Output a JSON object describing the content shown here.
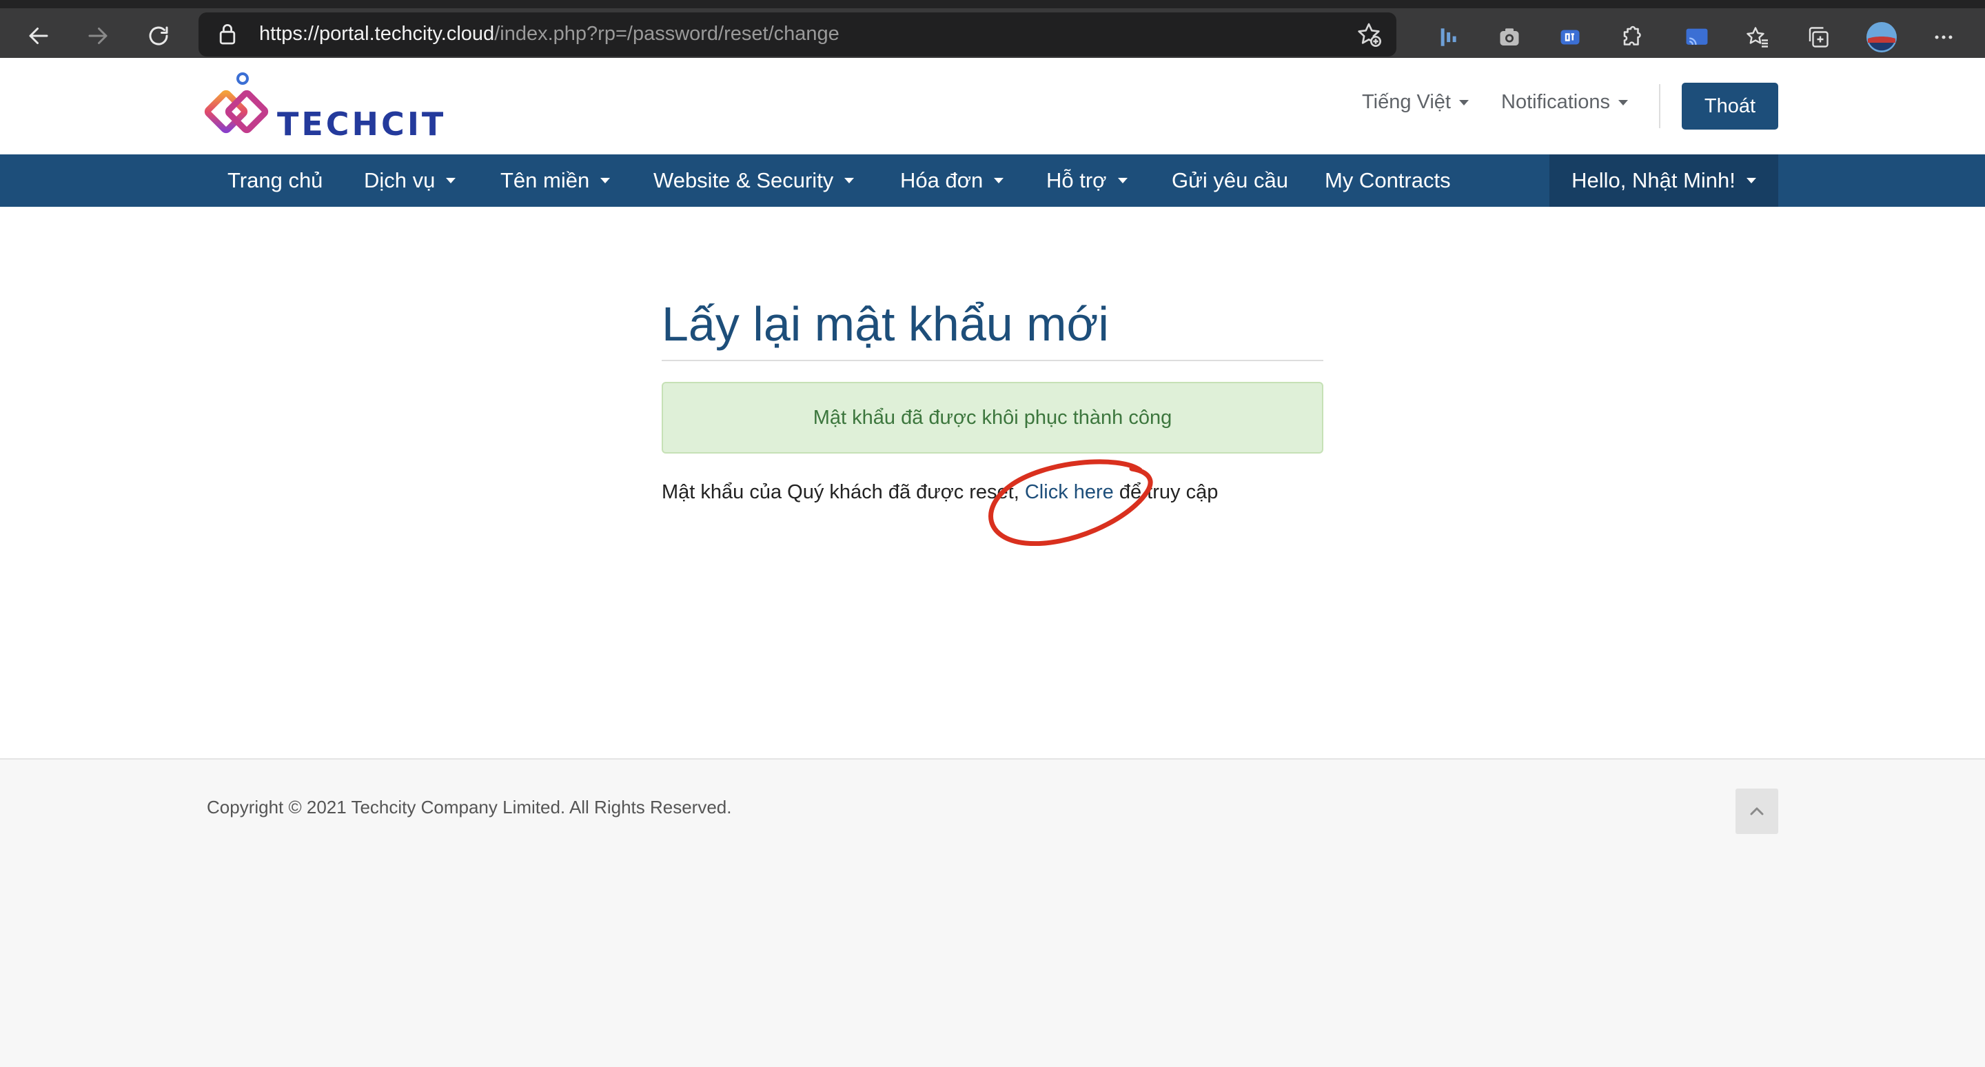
{
  "browser": {
    "url_host": "https://portal.techcity.cloud",
    "url_path": "/index.php?rp=/password/reset/change"
  },
  "header": {
    "logo_text": "TECHCITY",
    "language": "Tiếng Việt",
    "notifications": "Notifications",
    "logout": "Thoát"
  },
  "nav": {
    "items": [
      {
        "label": "Trang chủ"
      },
      {
        "label": "Dịch vụ"
      },
      {
        "label": "Tên miền"
      },
      {
        "label": "Website & Security"
      },
      {
        "label": "Hóa đơn"
      },
      {
        "label": "Hỗ trợ"
      },
      {
        "label": "Gửi yêu cầu"
      },
      {
        "label": "My Contracts"
      }
    ],
    "user": "Hello, Nhật Minh!"
  },
  "main": {
    "title": "Lấy lại mật khẩu mới",
    "alert": "Mật khẩu đã được khôi phục thành công",
    "message_before": "Mật khẩu của Quý khách đã được reset, ",
    "link": "Click here",
    "message_after": " để truy cập"
  },
  "footer": {
    "copyright": "Copyright © 2021 Techcity Company Limited. All Rights Reserved."
  },
  "colors": {
    "brand": "#1d4e7a",
    "alert_bg": "#dff0d8",
    "alert_text": "#3c763d",
    "annotation": "#d9301e"
  }
}
